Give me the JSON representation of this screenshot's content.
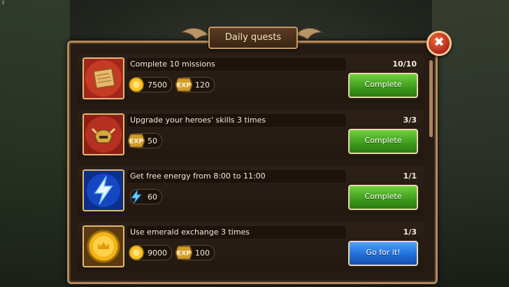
{
  "corner_label": "3",
  "dialog": {
    "title": "Daily quests",
    "close_glyph": "✖"
  },
  "quests": [
    {
      "title": "Complete 10 missions",
      "progress": "10/10",
      "icon": "scroll-icon",
      "rewards": [
        {
          "icon": "gold-coin-icon",
          "value": "7500"
        },
        {
          "icon": "exp-icon",
          "label": "EXP",
          "value": "120"
        }
      ],
      "button": {
        "label": "Complete",
        "style": "green"
      }
    },
    {
      "title": "Upgrade your heroes' skills 3 times",
      "progress": "3/3",
      "icon": "helmet-icon",
      "rewards": [
        {
          "icon": "exp-icon",
          "label": "EXP",
          "value": "50"
        }
      ],
      "button": {
        "label": "Complete",
        "style": "green"
      }
    },
    {
      "title": "Get free energy from 8:00 to 11:00",
      "progress": "1/1",
      "icon": "lightning-icon",
      "rewards": [
        {
          "icon": "energy-icon",
          "value": "60"
        }
      ],
      "button": {
        "label": "Complete",
        "style": "green"
      }
    },
    {
      "title": "Use emerald exchange 3 times",
      "progress": "1/3",
      "icon": "crown-coin-icon",
      "rewards": [
        {
          "icon": "gold-coin-icon",
          "value": "9000"
        },
        {
          "icon": "exp-icon",
          "label": "EXP",
          "value": "100"
        }
      ],
      "button": {
        "label": "Go for it!",
        "style": "blue"
      }
    }
  ],
  "colors": {
    "complete_button": "#3d9a1c",
    "go_button": "#1f6ad6",
    "frame_border": "#b38a5a"
  }
}
